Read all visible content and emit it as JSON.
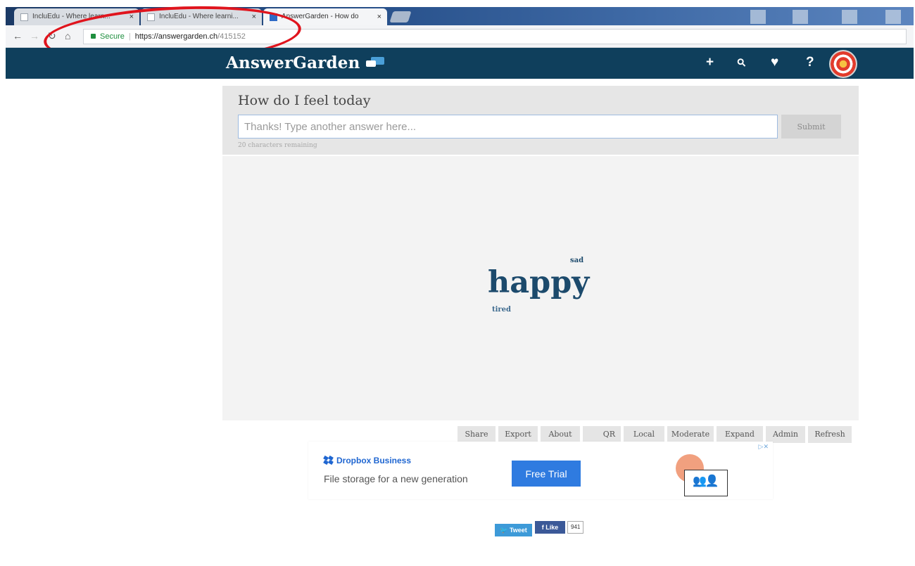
{
  "browser": {
    "tabs": [
      {
        "title": "IncluEdu - Where learn..."
      },
      {
        "title": "IncluEdu - Where learni..."
      },
      {
        "title": "AnswerGarden - How do"
      }
    ],
    "tab_close": "×",
    "url": {
      "secure_label": "Secure",
      "host": "https://answergarden.ch",
      "path": "/415152"
    }
  },
  "site": {
    "logo": "AnswerGarden",
    "header_icons": [
      "plus-icon",
      "search-icon",
      "heart-icon",
      "help-icon"
    ],
    "header_glyphs": {
      "plus": "+",
      "search": "⚲",
      "heart": "♥",
      "help": "?"
    }
  },
  "question": {
    "title": "How do I feel today",
    "input_placeholder": "Thanks! Type another answer here...",
    "input_value": "",
    "submit_label": "Submit",
    "chars_remaining": "20 characters remaining"
  },
  "cloud": {
    "words": [
      {
        "text": "happy"
      },
      {
        "text": "sad"
      },
      {
        "text": "tired"
      }
    ]
  },
  "actions": [
    "Share",
    "Export",
    "About",
    "QR",
    "Local",
    "Moderate",
    "Expand",
    "Admin",
    "Refresh"
  ],
  "ad": {
    "brand": "Dropbox Business",
    "tagline": "File storage for a new generation",
    "cta": "Free Trial",
    "adchoices": "▷✕"
  },
  "social": {
    "tweet": "Tweet",
    "like": "Like",
    "like_count": "941"
  },
  "colors": {
    "header_bg": "#0f3f5c",
    "word_color": "#1c4a6c",
    "cta_blue": "#2f7be0",
    "annotation_red": "#e0141d"
  }
}
